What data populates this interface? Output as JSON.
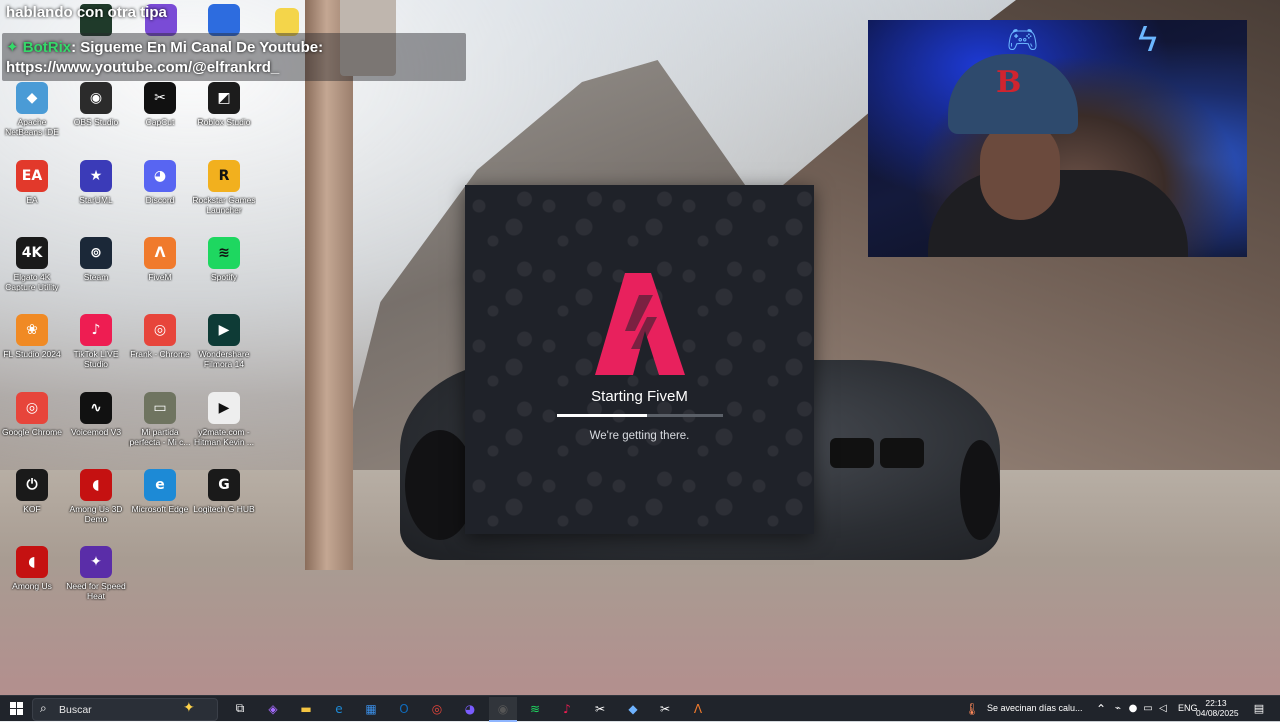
{
  "chat": {
    "top_message": "hablando con otra tipa",
    "bot_name": "BotRix",
    "message": ": Sigueme En Mi Canal De Youtube:",
    "link": "https://www.youtube.com/@elfrankrd_"
  },
  "desktop_icons": [
    {
      "label": "Apache NetBeans IDE 24",
      "icon": "netbeans-icon",
      "color": "#4a9bd6",
      "glyph": "◆"
    },
    {
      "label": "OBS Studio",
      "icon": "obs-icon",
      "color": "#2b2b2b",
      "glyph": "◉"
    },
    {
      "label": "CapCut",
      "icon": "capcut-icon",
      "color": "#111111",
      "glyph": "✂"
    },
    {
      "label": "Roblox Studio",
      "icon": "roblox-studio-icon",
      "color": "#1c1c1c",
      "glyph": "◩"
    },
    {
      "label": "EA",
      "icon": "ea-icon",
      "color": "#e2392b",
      "glyph": "EA"
    },
    {
      "label": "StarUML",
      "icon": "staruml-icon",
      "color": "#3b3bb8",
      "glyph": "★"
    },
    {
      "label": "Discord",
      "icon": "discord-icon",
      "color": "#5865f2",
      "glyph": "◕"
    },
    {
      "label": "Rockstar Games Launcher",
      "icon": "rockstar-icon",
      "color": "#f2b01e",
      "glyph": "R"
    },
    {
      "label": "Elgato 4K Capture Utility",
      "icon": "elgato-icon",
      "color": "#1a1a1a",
      "glyph": "4K"
    },
    {
      "label": "Steam",
      "icon": "steam-icon",
      "color": "#1b2838",
      "glyph": "⊚"
    },
    {
      "label": "FiveM",
      "icon": "fivem-icon",
      "color": "#f07a2c",
      "glyph": "Λ"
    },
    {
      "label": "Spotify",
      "icon": "spotify-icon",
      "color": "#1ed760",
      "glyph": "≋"
    },
    {
      "label": "FL Studio 2024",
      "icon": "fl-studio-icon",
      "color": "#f08a24",
      "glyph": "❀"
    },
    {
      "label": "TikTok LIVE Studio",
      "icon": "tiktok-live-icon",
      "color": "#ee1d52",
      "glyph": "♪"
    },
    {
      "label": "Frank - Chrome",
      "icon": "chrome-icon",
      "color": "#e7453b",
      "glyph": "◎"
    },
    {
      "label": "Wondershare Filmora 14",
      "icon": "filmora-icon",
      "color": "#0e3b36",
      "glyph": "▶"
    },
    {
      "label": "Google Chrome",
      "icon": "chrome-icon",
      "color": "#e7453b",
      "glyph": "◎"
    },
    {
      "label": "Voicemod V3",
      "icon": "voicemod-icon",
      "color": "#111111",
      "glyph": "∿"
    },
    {
      "label": "Mi partida perfecta - Mi c...",
      "icon": "video-thumbnail-icon",
      "color": "#6f7460",
      "glyph": "▭"
    },
    {
      "label": "y2mate.com - Hitman Kevin ...",
      "icon": "media-file-icon",
      "color": "#eeeeee",
      "glyph": "▶"
    },
    {
      "label": "KOF",
      "icon": "kof-icon",
      "color": "#1a1a1a",
      "glyph": "⏻"
    },
    {
      "label": "Among Us 3D Demo",
      "icon": "among-us-icon",
      "color": "#c51111",
      "glyph": "◖"
    },
    {
      "label": "Microsoft Edge",
      "icon": "edge-icon",
      "color": "#1d8ad6",
      "glyph": "e"
    },
    {
      "label": "Logitech G HUB",
      "icon": "logitech-icon",
      "color": "#1a1a1a",
      "glyph": "G"
    },
    {
      "label": "Among Us",
      "icon": "among-us-icon",
      "color": "#c51111",
      "glyph": "◖"
    },
    {
      "label": "Need for Speed Heat",
      "icon": "nfs-heat-icon",
      "color": "#5a2da8",
      "glyph": "✦"
    }
  ],
  "launcher": {
    "title": "Starting FiveM",
    "subtitle": "We're getting there.",
    "progress": 0.54,
    "accent": "#e8215d",
    "background": "#1f2229"
  },
  "taskbar": {
    "search_placeholder": "Buscar",
    "apps": [
      {
        "icon": "task-view-icon",
        "color": "#ffffff",
        "glyph": "⧉"
      },
      {
        "icon": "copilot-icon",
        "color": "#a66bff",
        "glyph": "◈"
      },
      {
        "icon": "file-explorer-icon",
        "color": "#f5c542",
        "glyph": "▬"
      },
      {
        "icon": "edge-icon",
        "color": "#1d8ad6",
        "glyph": "e"
      },
      {
        "icon": "microsoft-store-icon",
        "color": "#3a8ee6",
        "glyph": "▦"
      },
      {
        "icon": "outlook-icon",
        "color": "#0f6cbd",
        "glyph": "O"
      },
      {
        "icon": "chrome-icon",
        "color": "#e7453b",
        "glyph": "◎"
      },
      {
        "icon": "messenger-icon",
        "color": "#7a5cff",
        "glyph": "◕"
      },
      {
        "icon": "obs-icon",
        "color": "#555555",
        "glyph": "◉"
      },
      {
        "icon": "spotify-icon",
        "color": "#1ed760",
        "glyph": "≋"
      },
      {
        "icon": "tiktok-live-icon",
        "color": "#ee1d52",
        "glyph": "♪"
      },
      {
        "icon": "capcut-icon",
        "color": "#ffffff",
        "glyph": "✂"
      },
      {
        "icon": "app-icon",
        "color": "#6fb3ff",
        "glyph": "◆"
      },
      {
        "icon": "capcut-icon",
        "color": "#ffffff",
        "glyph": "✂"
      },
      {
        "icon": "fivem-icon",
        "color": "#f07a2c",
        "glyph": "Λ"
      }
    ],
    "weather_text": "Se avecinan días calu...",
    "language": "ENG",
    "time": "22:13",
    "date": "04/08/2025"
  }
}
